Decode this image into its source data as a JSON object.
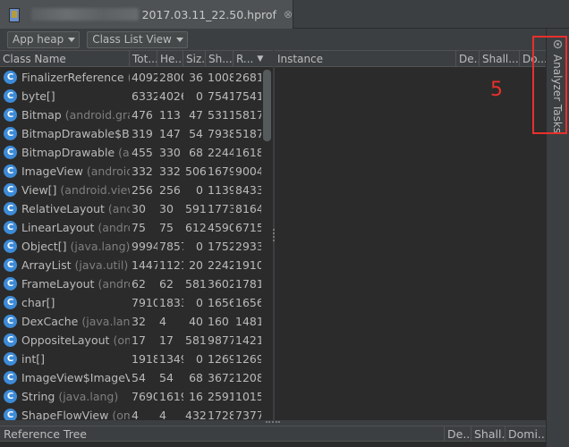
{
  "editor_tab": {
    "title": "2017.03.11_22.50.hprof",
    "close": "⊗"
  },
  "toolbar": {
    "heap_select": "App heap",
    "view_select": "Class List View"
  },
  "class_table": {
    "headers": {
      "name": "Class Name",
      "total": "Tot...",
      "heap": "He...",
      "size": "Siz...",
      "shallow": "Sh...",
      "retained": "R..."
    },
    "sort_indicator": "▼",
    "rows": [
      {
        "cls": "FinalizerReference",
        "pkg": "(ja",
        "total": "4092",
        "heap": "2800",
        "size": "36",
        "shallow": "1008",
        "retained": "2681"
      },
      {
        "cls": "byte[]",
        "pkg": "",
        "total": "6332",
        "heap": "4026",
        "size": "0",
        "shallow": "7541",
        "retained": "7541"
      },
      {
        "cls": "Bitmap",
        "pkg": "(android.grap",
        "total": "476",
        "heap": "113",
        "size": "47",
        "shallow": "5311",
        "retained": "5817"
      },
      {
        "cls": "BitmapDrawable$Bitm",
        "pkg": "",
        "total": "319",
        "heap": "147",
        "size": "54",
        "shallow": "7938",
        "retained": "5187"
      },
      {
        "cls": "BitmapDrawable",
        "pkg": "(and",
        "total": "455",
        "heap": "330",
        "size": "68",
        "shallow": "2244",
        "retained": "1618"
      },
      {
        "cls": "ImageView",
        "pkg": "(android.",
        "total": "332",
        "heap": "332",
        "size": "506",
        "shallow": "1679",
        "retained": "9004"
      },
      {
        "cls": "View[]",
        "pkg": "(android.view)",
        "total": "256",
        "heap": "256",
        "size": "0",
        "shallow": "1139",
        "retained": "8433"
      },
      {
        "cls": "RelativeLayout",
        "pkg": "(andro",
        "total": "30",
        "heap": "30",
        "size": "591",
        "shallow": "1773",
        "retained": "8164"
      },
      {
        "cls": "LinearLayout",
        "pkg": "(androi",
        "total": "75",
        "heap": "75",
        "size": "612",
        "shallow": "4590",
        "retained": "6715"
      },
      {
        "cls": "Object[]",
        "pkg": "(java.lang)",
        "total": "9994",
        "heap": "7857",
        "size": "0",
        "shallow": "1752",
        "retained": "2933"
      },
      {
        "cls": "ArrayList",
        "pkg": "(java.util)",
        "total": "1447",
        "heap": "1121",
        "size": "20",
        "shallow": "2242",
        "retained": "1910"
      },
      {
        "cls": "FrameLayout",
        "pkg": "(androi",
        "total": "62",
        "heap": "62",
        "size": "581",
        "shallow": "3602",
        "retained": "1781"
      },
      {
        "cls": "char[]",
        "pkg": "",
        "total": "7910",
        "heap": "1833",
        "size": "0",
        "shallow": "1656",
        "retained": "1656"
      },
      {
        "cls": "DexCache",
        "pkg": "(java.lang)",
        "total": "32",
        "heap": "4",
        "size": "40",
        "shallow": "160",
        "retained": "1481"
      },
      {
        "cls": "OppositeLayout",
        "pkg": "(om",
        "total": "17",
        "heap": "17",
        "size": "581",
        "shallow": "9877",
        "retained": "1421"
      },
      {
        "cls": "int[]",
        "pkg": "",
        "total": "1918",
        "heap": "1349",
        "size": "0",
        "shallow": "1269",
        "retained": "1269"
      },
      {
        "cls": "ImageView$ImageVie",
        "pkg": "",
        "total": "54",
        "heap": "54",
        "size": "68",
        "shallow": "3672",
        "retained": "1208"
      },
      {
        "cls": "String",
        "pkg": "(java.lang)",
        "total": "7690",
        "heap": "1619",
        "size": "16",
        "shallow": "2591",
        "retained": "1015"
      },
      {
        "cls": "ShapeFlowView",
        "pkg": "(oms",
        "total": "4",
        "heap": "4",
        "size": "432",
        "shallow": "1728",
        "retained": "7377"
      }
    ]
  },
  "instance_table": {
    "headers": {
      "instance": "Instance",
      "depth": "De...",
      "shallow": "Shall...",
      "dominating": "Do..."
    }
  },
  "reference_tree": {
    "headers": {
      "title": "Reference Tree",
      "depth": "De...",
      "shallow": "Shall...",
      "dominating": "Domi..."
    }
  },
  "side_panel": {
    "label": "Analyzer Tasks"
  },
  "annotation": {
    "number": "5",
    "color": "#e8302d"
  },
  "class_icon_letter": "C"
}
